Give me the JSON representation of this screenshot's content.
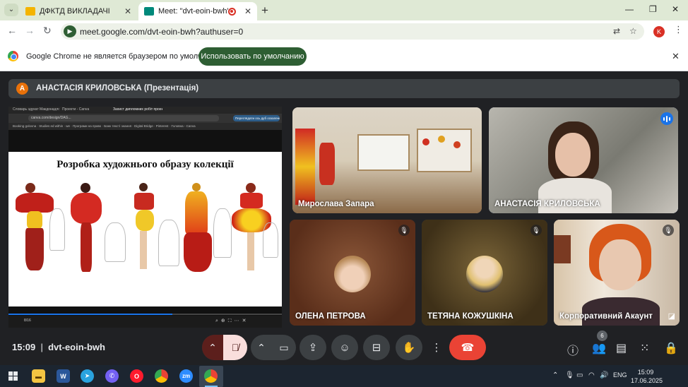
{
  "browser": {
    "tabs": [
      {
        "title": "ДФКТД ВИКЛАДАЧІ",
        "active": false,
        "favicon_color": "#f4b400"
      },
      {
        "title": "Meet: \"dvt-eoin-bwh\"",
        "active": true,
        "favicon_color": "#00897b",
        "recording": true
      }
    ],
    "url": "meet.google.com/dvt-eoin-bwh?authuser=0",
    "profile_initial": "K",
    "accent": "#2e5e33"
  },
  "infobar": {
    "message": "Google Chrome не является браузером по умолчанию.",
    "button_label": "Использовать по умолчанию"
  },
  "meet": {
    "presenter": {
      "initial": "A",
      "label": "АНАСТАСІЯ КРИЛОВСЬКА (Презентація)"
    },
    "shared_screen": {
      "browser_tabs": [
        "Словарь эдукат Макдонадлоу...",
        "Проекти - Canva",
        "Захист дипломних робіт проекти..."
      ],
      "url": "canva.com/design/DAG...",
      "share_button": "Переглядати ось дуб оскаленою ос 1",
      "bookmarks": "Booking golovna  ·  Studies ed within  ·  we  ·  Програми на право  ·  Банк тексті знання  ·  Digital Bridge  ·  Pinterest  ·  Головна - Canva",
      "slide_title": "Розробка художнього образу колекції",
      "page_indicator": "8/16",
      "progress": 0.6
    },
    "participants": [
      {
        "name": "Мирослава Запара",
        "muted": false,
        "speaking": false
      },
      {
        "name": "АНАСТАСІЯ КРИЛОВСЬКА",
        "muted": false,
        "speaking": true
      },
      {
        "name": "ОЛЕНА ПЕТРОВА",
        "muted": true,
        "speaking": false
      },
      {
        "name": "ТЕТЯНА КОЖУШКІНА",
        "muted": true,
        "speaking": false
      },
      {
        "name": "Корпоративний Акаунт",
        "muted": true,
        "speaking": false
      }
    ],
    "time": "15:09",
    "separator": "|",
    "meeting_code": "dvt-eoin-bwh",
    "participant_count": "6",
    "icons": [
      "chevron-up-icon",
      "mic-off-icon",
      "camera-icon",
      "present-icon",
      "emoji-icon",
      "captions-icon",
      "raise-hand-icon",
      "more-icon",
      "end-call-icon",
      "info-icon",
      "people-icon",
      "chat-icon",
      "activities-icon",
      "host-controls-icon"
    ]
  },
  "taskbar": {
    "apps": [
      "file-explorer",
      "word",
      "telegram",
      "viber",
      "opera",
      "chrome",
      "zoom",
      "chrome-profile"
    ],
    "language": "ENG",
    "clock_time": "15:09",
    "clock_date": "17.06.2025"
  }
}
